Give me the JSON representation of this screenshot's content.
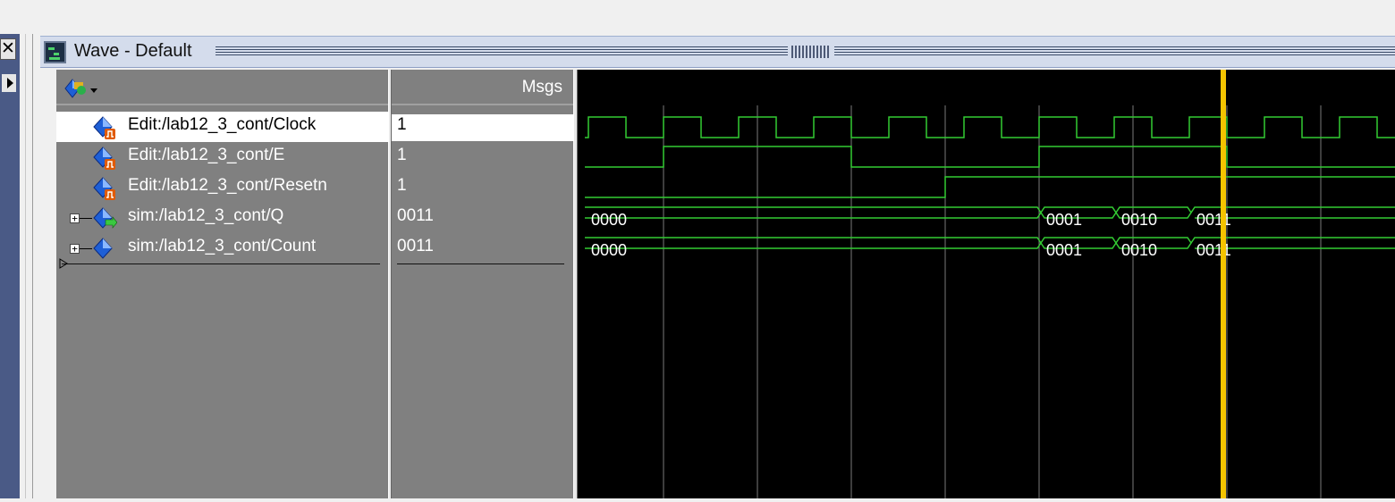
{
  "window": {
    "title": "Wave - Default",
    "close_glyph": "✕"
  },
  "toolbar": {
    "icon": "add-wave-icon",
    "dropdown_icon": "chevron-down-icon"
  },
  "columns": {
    "msgs_header": "Msgs"
  },
  "signals": [
    {
      "name": "Edit:/lab12_3_cont/Clock",
      "value": "1",
      "kind": "edit",
      "selected": true
    },
    {
      "name": "Edit:/lab12_3_cont/E",
      "value": "1",
      "kind": "edit",
      "selected": false
    },
    {
      "name": "Edit:/lab12_3_cont/Resetn",
      "value": "1",
      "kind": "edit",
      "selected": false
    },
    {
      "name": "sim:/lab12_3_cont/Q",
      "value": "0011",
      "kind": "sim-out",
      "expandable": true
    },
    {
      "name": "sim:/lab12_3_cont/Count",
      "value": "0011",
      "kind": "sim",
      "expandable": true
    }
  ],
  "bus_values": {
    "q": [
      "0000",
      "0001",
      "0010",
      "0011"
    ],
    "count": [
      "0000",
      "0001",
      "0010",
      "0011"
    ]
  },
  "colors": {
    "wave_green": "#33cc33",
    "cursor": "#f5c400",
    "grid": "#7a7a7a",
    "wave_bg": "#000000",
    "panel_gray": "#808080"
  }
}
